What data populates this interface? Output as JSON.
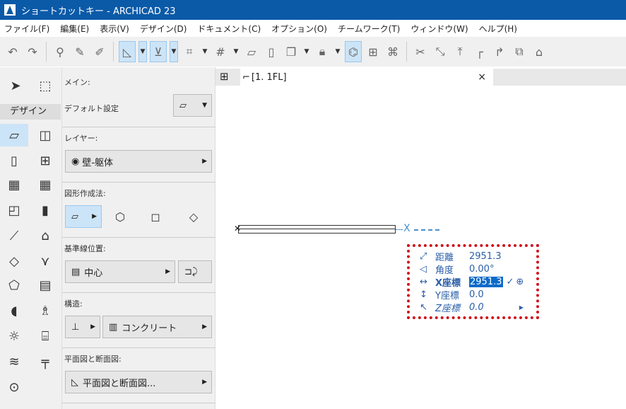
{
  "title": "ショートカットキー - ARCHICAD 23",
  "menu": [
    "ファイル(F)",
    "編集(E)",
    "表示(V)",
    "デザイン(D)",
    "ドキュメント(C)",
    "オプション(O)",
    "チームワーク(T)",
    "ウィンドウ(W)",
    "ヘルプ(H)"
  ],
  "tools": {
    "group_label": "デザイン"
  },
  "info": {
    "main_label": "メイン:",
    "default_label": "デフォルト設定",
    "layer_label": "レイヤー:",
    "layer_value": "壁-躯体",
    "geometry_label": "図形作成法:",
    "refline_label": "基準線位置:",
    "refline_value": "中心",
    "structure_label": "構造:",
    "structure_value": "コンクリート",
    "floorplan_label": "平面図と断面図:",
    "floorplan_value": "平面図と断面図..."
  },
  "tab": {
    "label": "[1. 1FL]",
    "close": "×"
  },
  "canvas": {
    "cursor_marker": "X"
  },
  "tracker": {
    "rows": [
      {
        "icon": "⤢",
        "label": "距離",
        "value": "2951.3"
      },
      {
        "icon": "◁",
        "label": "角度",
        "value": "0.00°"
      },
      {
        "icon": "↔",
        "label": "X座標",
        "value": "2951.3"
      },
      {
        "icon": "↕",
        "label": "Y座標",
        "value": "0.0"
      },
      {
        "icon": "↖",
        "label": "Z座標",
        "value": "0.0"
      }
    ],
    "confirm": "✓",
    "origin": "⊕"
  },
  "colors": {
    "titlebar": "#0b5aa8",
    "tracker_text": "#2a5ea8",
    "tracker_border": "#d0101a",
    "selection": "#cce4f7"
  }
}
